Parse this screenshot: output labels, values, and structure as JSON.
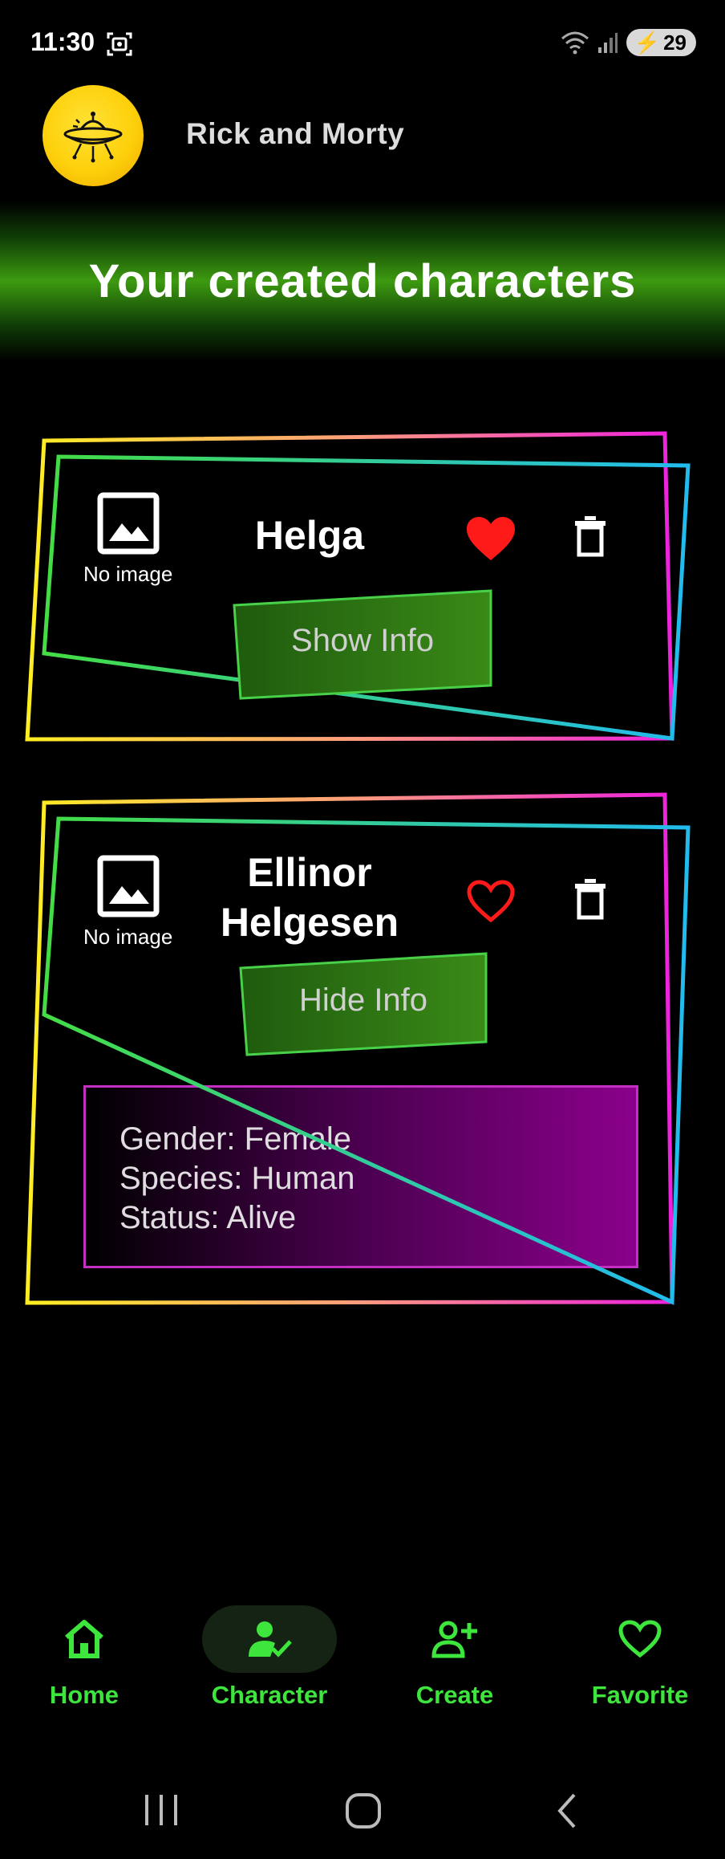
{
  "status_bar": {
    "time": "11:30",
    "battery": "29"
  },
  "header": {
    "app_title": "Rick and Morty"
  },
  "banner": {
    "title": "Your created characters"
  },
  "cards": [
    {
      "name": "Helga",
      "image_label": "No image",
      "favorite": true,
      "info_button": "Show Info"
    },
    {
      "name_line1": "Ellinor",
      "name_line2": "Helgesen",
      "image_label": "No image",
      "favorite": false,
      "info_button": "Hide Info",
      "info": {
        "gender": "Gender: Female",
        "species": "Species: Human",
        "status": "Status: Alive"
      }
    }
  ],
  "bottom_nav": {
    "items": [
      {
        "label": "Home",
        "icon": "home-icon"
      },
      {
        "label": "Character",
        "icon": "person-check-icon",
        "selected": true
      },
      {
        "label": "Create",
        "icon": "person-add-icon"
      },
      {
        "label": "Favorite",
        "icon": "heart-outline-icon"
      }
    ]
  },
  "colors": {
    "accent": "#3de53d",
    "favorite": "#ff1a1a",
    "panel": "#8b008b"
  }
}
